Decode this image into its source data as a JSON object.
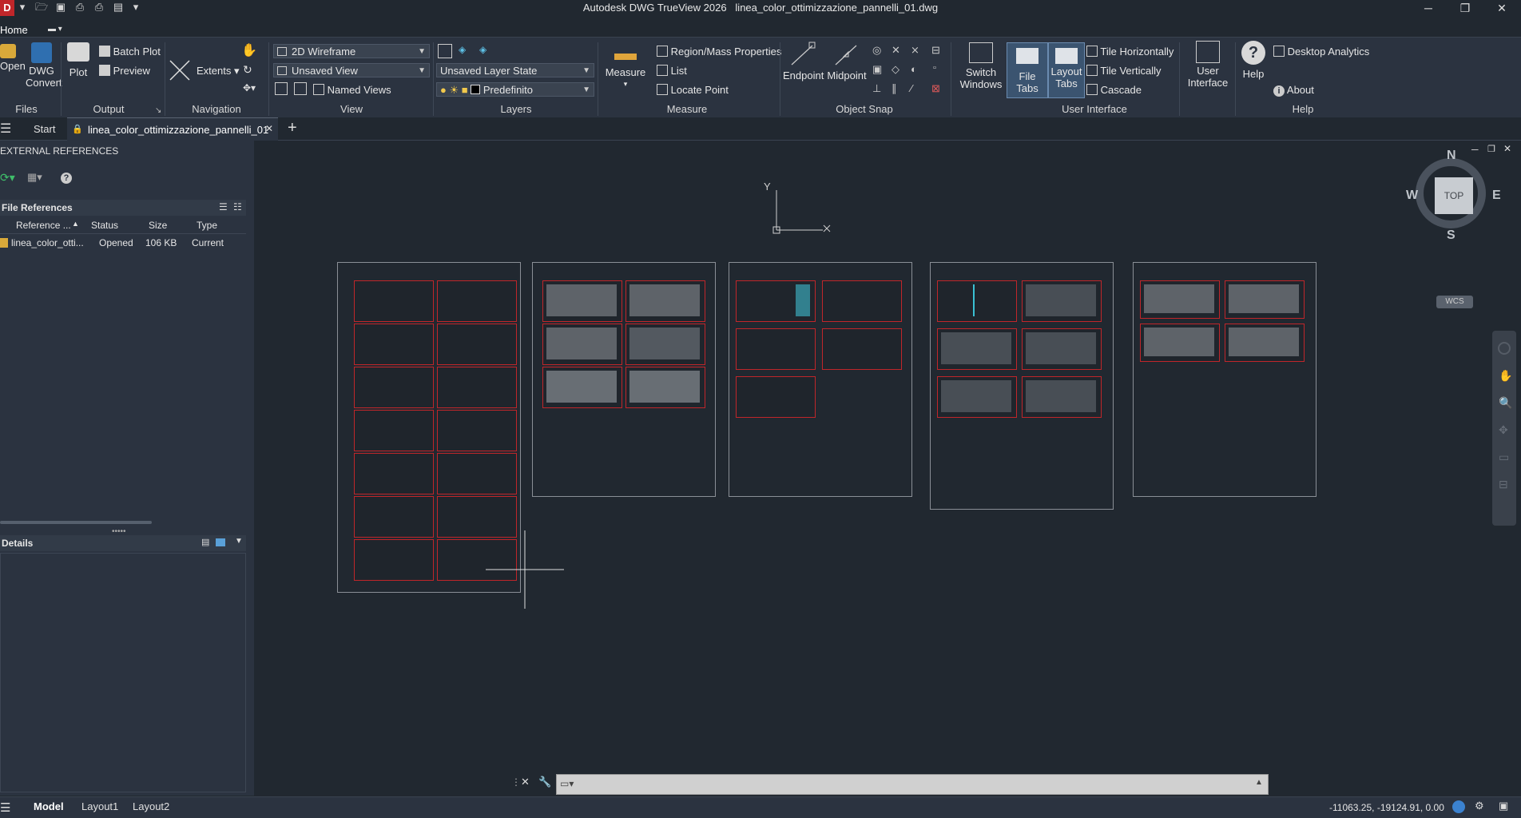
{
  "titlebar": {
    "app_title": "Autodesk DWG TrueView 2026",
    "file_title": "linea_color_ottimizzazione_pannelli_01.dwg",
    "app_badge": "D"
  },
  "ribbon_tabs": {
    "home": "Home"
  },
  "ribbon": {
    "files": {
      "label": "Files",
      "open": "Open",
      "dwg_convert_1": "DWG",
      "dwg_convert_2": "Convert"
    },
    "output": {
      "label": "Output",
      "plot": "Plot",
      "batch_plot": "Batch Plot",
      "preview": "Preview"
    },
    "navigation": {
      "label": "Navigation",
      "extents": "Extents"
    },
    "view": {
      "label": "View",
      "visual_style": "2D Wireframe",
      "saved_view": "Unsaved View",
      "named_views": "Named Views"
    },
    "layers": {
      "label": "Layers",
      "layer_state": "Unsaved Layer State",
      "current_layer": "Predefinito"
    },
    "measure": {
      "label": "Measure",
      "measure": "Measure",
      "region_mass": "Region/Mass Properties",
      "list": "List",
      "locate_point": "Locate Point"
    },
    "object_snap": {
      "label": "Object Snap",
      "endpoint": "Endpoint",
      "midpoint": "Midpoint"
    },
    "user_interface": {
      "label": "User Interface",
      "switch_windows_1": "Switch",
      "switch_windows_2": "Windows",
      "file_tabs": "File Tabs",
      "layout_tabs_1": "Layout",
      "layout_tabs_2": "Tabs",
      "tile_h": "Tile Horizontally",
      "tile_v": "Tile Vertically",
      "cascade": "Cascade"
    },
    "ui2": {
      "user_interface_1": "User",
      "user_interface_2": "Interface"
    },
    "help": {
      "label": "Help",
      "help": "Help",
      "desktop_analytics": "Desktop Analytics",
      "about": "About"
    }
  },
  "doc_tabs": {
    "start": "Start",
    "active": "linea_color_ottimizzazione_pannelli_01"
  },
  "palette": {
    "title": "EXTERNAL REFERENCES",
    "file_references": "File References",
    "columns": [
      "Reference ...",
      "Status",
      "Size",
      "Type"
    ],
    "rows": [
      {
        "name": "linea_color_otti...",
        "status": "Opened",
        "size": "106 KB",
        "type": "Current"
      }
    ],
    "details": "Details"
  },
  "viewcube": {
    "n": "N",
    "s": "S",
    "e": "E",
    "w": "W",
    "top": "TOP",
    "wcs": "WCS"
  },
  "ucs": {
    "y": "Y"
  },
  "status": {
    "model": "Model",
    "layout1": "Layout1",
    "layout2": "Layout2",
    "coords": "-11063.25, -19124.91, 0.00"
  },
  "colors": {
    "viewport_red": "#c0262a",
    "background": "#212830",
    "accent_blue": "#2f6fb0"
  }
}
